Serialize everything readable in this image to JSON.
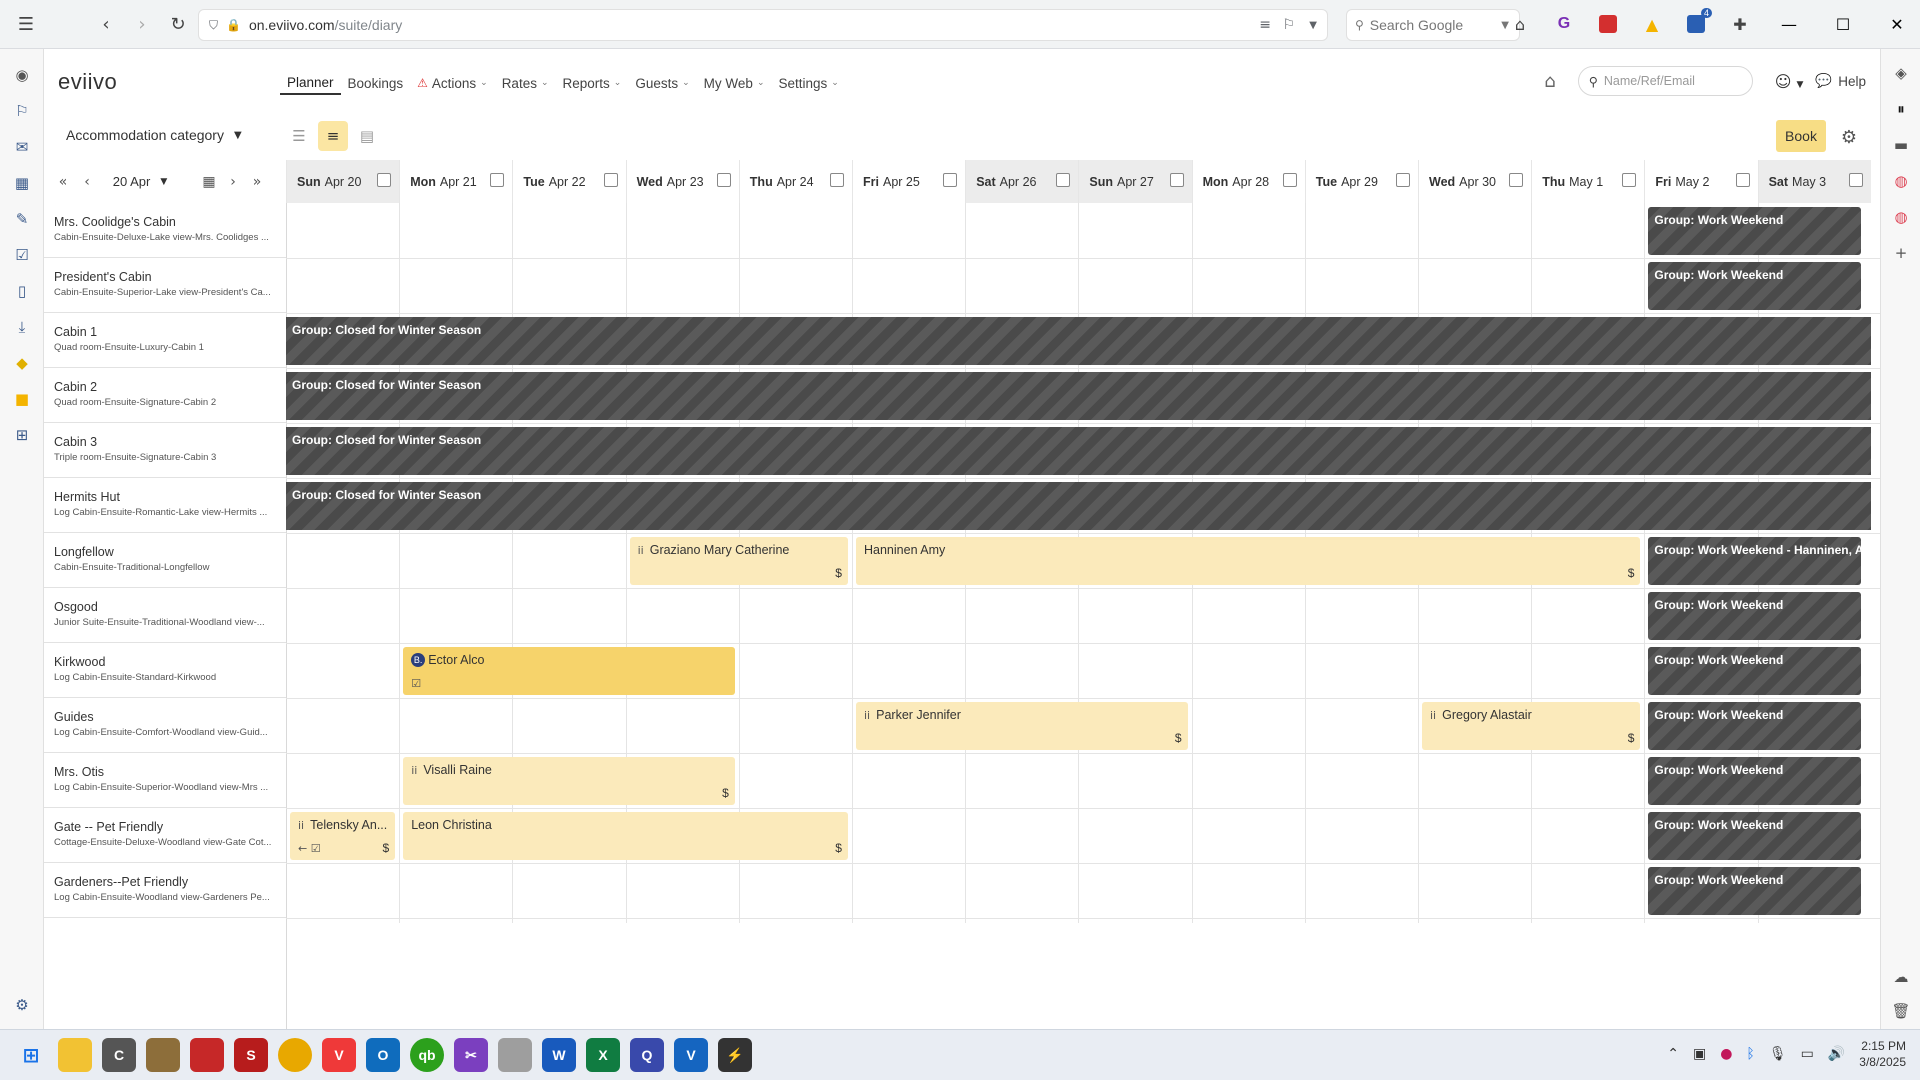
{
  "browser": {
    "url_host": "on.eviivo.com",
    "url_path": "/suite/diary",
    "search_placeholder": "Search Google",
    "ext_badge": "4"
  },
  "app": {
    "logo": "eviivo",
    "nav": [
      {
        "label": "Planner"
      },
      {
        "label": "Bookings"
      },
      {
        "label": "Actions"
      },
      {
        "label": "Rates"
      },
      {
        "label": "Reports"
      },
      {
        "label": "Guests"
      },
      {
        "label": "My Web"
      },
      {
        "label": "Settings"
      }
    ],
    "search_placeholder": "Name/Ref/Email",
    "help": "Help",
    "category": "Accommodation category",
    "book": "Book",
    "date": "20 Apr"
  },
  "days": [
    {
      "dow": "Sun",
      "date": "Apr 20",
      "weekend": true
    },
    {
      "dow": "Mon",
      "date": "Apr 21",
      "weekend": false
    },
    {
      "dow": "Tue",
      "date": "Apr 22",
      "weekend": false
    },
    {
      "dow": "Wed",
      "date": "Apr 23",
      "weekend": false
    },
    {
      "dow": "Thu",
      "date": "Apr 24",
      "weekend": false
    },
    {
      "dow": "Fri",
      "date": "Apr 25",
      "weekend": false
    },
    {
      "dow": "Sat",
      "date": "Apr 26",
      "weekend": true
    },
    {
      "dow": "Sun",
      "date": "Apr 27",
      "weekend": true
    },
    {
      "dow": "Mon",
      "date": "Apr 28",
      "weekend": false
    },
    {
      "dow": "Tue",
      "date": "Apr 29",
      "weekend": false
    },
    {
      "dow": "Wed",
      "date": "Apr 30",
      "weekend": false
    },
    {
      "dow": "Thu",
      "date": "May 1",
      "weekend": false
    },
    {
      "dow": "Fri",
      "date": "May 2",
      "weekend": false
    },
    {
      "dow": "Sat",
      "date": "May 3",
      "weekend": true
    }
  ],
  "rooms": [
    {
      "name": "Mrs. Coolidge's Cabin",
      "desc": "Cabin-Ensuite-Deluxe-Lake view-Mrs. Coolidges ..."
    },
    {
      "name": "President's Cabin",
      "desc": "Cabin-Ensuite-Superior-Lake view-President's Ca..."
    },
    {
      "name": "Cabin 1",
      "desc": "Quad room-Ensuite-Luxury-Cabin 1"
    },
    {
      "name": "Cabin 2",
      "desc": "Quad room-Ensuite-Signature-Cabin 2"
    },
    {
      "name": "Cabin 3",
      "desc": "Triple room-Ensuite-Signature-Cabin 3"
    },
    {
      "name": "Hermits Hut",
      "desc": "Log Cabin-Ensuite-Romantic-Lake view-Hermits ..."
    },
    {
      "name": "Longfellow",
      "desc": "Cabin-Ensuite-Traditional-Longfellow"
    },
    {
      "name": "Osgood",
      "desc": "Junior Suite-Ensuite-Traditional-Woodland view-..."
    },
    {
      "name": "Kirkwood",
      "desc": "Log Cabin-Ensuite-Standard-Kirkwood"
    },
    {
      "name": "Guides",
      "desc": "Log Cabin-Ensuite-Comfort-Woodland view-Guid..."
    },
    {
      "name": "Mrs. Otis",
      "desc": "Log Cabin-Ensuite-Superior-Woodland view-Mrs ..."
    },
    {
      "name": "Gate -- Pet Friendly",
      "desc": "Cottage-Ensuite-Deluxe-Woodland view-Gate Cot..."
    },
    {
      "name": "Gardeners--Pet Friendly",
      "desc": "Log Cabin-Ensuite-Woodland view-Gardeners Pe..."
    }
  ],
  "blocks": {
    "work_weekend": "Group: Work Weekend",
    "closed_winter": "Group: Closed for Winter Season",
    "work_weekend_hanninen": "Group: Work Weekend - Hanninen, Amy"
  },
  "bookings": {
    "graziano": "Graziano Mary Catherine",
    "hanninen": "Hanninen Amy",
    "ector": "Ector Alco",
    "parker": "Parker Jennifer",
    "gregory": "Gregory Alastair",
    "visalli": "Visalli Raine",
    "telensky": "Telensky An...",
    "leon": "Leon Christina",
    "dollar": "$",
    "ii": "ii",
    "b": "B."
  },
  "taskbar": {
    "time": "2:15 PM",
    "date": "3/8/2025"
  }
}
